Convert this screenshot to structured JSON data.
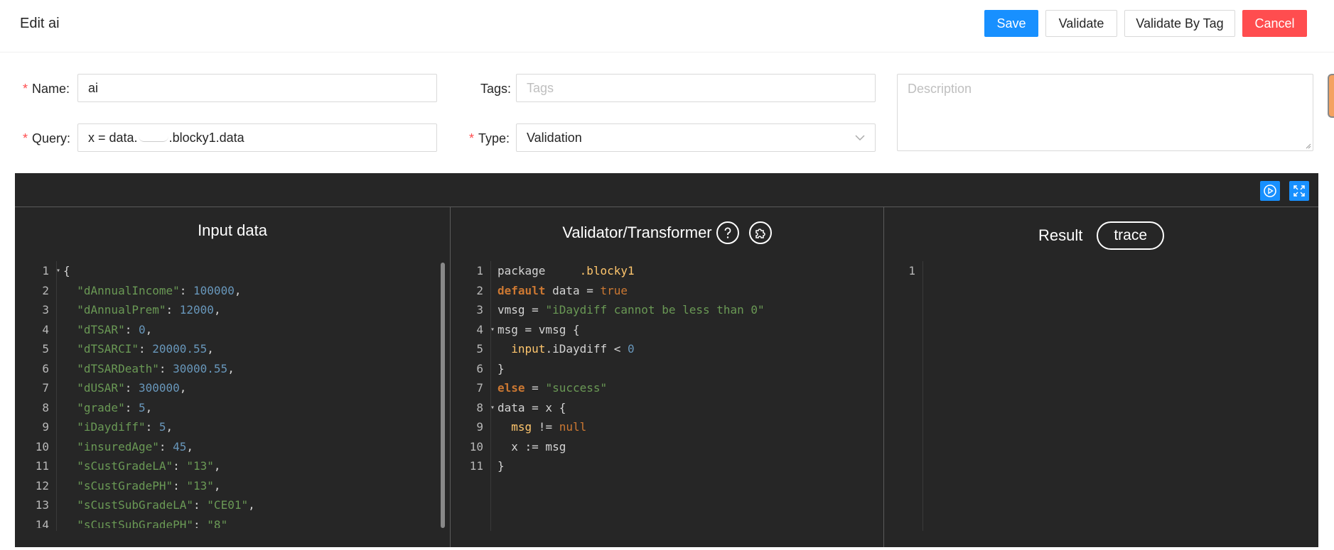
{
  "header": {
    "title": "Edit ai",
    "save": "Save",
    "validate": "Validate",
    "validate_by_tag": "Validate By Tag",
    "cancel": "Cancel"
  },
  "form": {
    "name_label": "Name:",
    "name_value": "ai",
    "tags_label": "Tags:",
    "tags_placeholder": "Tags",
    "description_placeholder": "Description",
    "query_label": "Query:",
    "query_value": "x = data.",
    "query_value_suffix": ".blocky1.data",
    "type_label": "Type:",
    "type_value": "Validation",
    "required_mark": "*"
  },
  "panels": {
    "input_title": "Input data",
    "validator_title": "Validator/Transformer",
    "result_title": "Result",
    "trace_label": "trace"
  },
  "input_code": [
    {
      "n": "1",
      "fold": true,
      "tokens": [
        [
          "p",
          "{"
        ]
      ]
    },
    {
      "n": "2",
      "tokens": [
        [
          "p",
          "  "
        ],
        [
          "s",
          "\"dAnnualIncome\""
        ],
        [
          "p",
          ": "
        ],
        [
          "n",
          "100000"
        ],
        [
          "p",
          ","
        ]
      ]
    },
    {
      "n": "3",
      "tokens": [
        [
          "p",
          "  "
        ],
        [
          "s",
          "\"dAnnualPrem\""
        ],
        [
          "p",
          ": "
        ],
        [
          "n",
          "12000"
        ],
        [
          "p",
          ","
        ]
      ]
    },
    {
      "n": "4",
      "tokens": [
        [
          "p",
          "  "
        ],
        [
          "s",
          "\"dTSAR\""
        ],
        [
          "p",
          ": "
        ],
        [
          "n",
          "0"
        ],
        [
          "p",
          ","
        ]
      ]
    },
    {
      "n": "5",
      "tokens": [
        [
          "p",
          "  "
        ],
        [
          "s",
          "\"dTSARCI\""
        ],
        [
          "p",
          ": "
        ],
        [
          "n",
          "20000.55"
        ],
        [
          "p",
          ","
        ]
      ]
    },
    {
      "n": "6",
      "tokens": [
        [
          "p",
          "  "
        ],
        [
          "s",
          "\"dTSARDeath\""
        ],
        [
          "p",
          ": "
        ],
        [
          "n",
          "30000.55"
        ],
        [
          "p",
          ","
        ]
      ]
    },
    {
      "n": "7",
      "tokens": [
        [
          "p",
          "  "
        ],
        [
          "s",
          "\"dUSAR\""
        ],
        [
          "p",
          ": "
        ],
        [
          "n",
          "300000"
        ],
        [
          "p",
          ","
        ]
      ]
    },
    {
      "n": "8",
      "tokens": [
        [
          "p",
          "  "
        ],
        [
          "s",
          "\"grade\""
        ],
        [
          "p",
          ": "
        ],
        [
          "n",
          "5"
        ],
        [
          "p",
          ","
        ]
      ]
    },
    {
      "n": "9",
      "tokens": [
        [
          "p",
          "  "
        ],
        [
          "s",
          "\"iDaydiff\""
        ],
        [
          "p",
          ": "
        ],
        [
          "n",
          "5"
        ],
        [
          "p",
          ","
        ]
      ]
    },
    {
      "n": "10",
      "tokens": [
        [
          "p",
          "  "
        ],
        [
          "s",
          "\"insuredAge\""
        ],
        [
          "p",
          ": "
        ],
        [
          "n",
          "45"
        ],
        [
          "p",
          ","
        ]
      ]
    },
    {
      "n": "11",
      "tokens": [
        [
          "p",
          "  "
        ],
        [
          "s",
          "\"sCustGradeLA\""
        ],
        [
          "p",
          ": "
        ],
        [
          "s",
          "\"13\""
        ],
        [
          "p",
          ","
        ]
      ]
    },
    {
      "n": "12",
      "tokens": [
        [
          "p",
          "  "
        ],
        [
          "s",
          "\"sCustGradePH\""
        ],
        [
          "p",
          ": "
        ],
        [
          "s",
          "\"13\""
        ],
        [
          "p",
          ","
        ]
      ]
    },
    {
      "n": "13",
      "tokens": [
        [
          "p",
          "  "
        ],
        [
          "s",
          "\"sCustSubGradeLA\""
        ],
        [
          "p",
          ": "
        ],
        [
          "s",
          "\"CE01\""
        ],
        [
          "p",
          ","
        ]
      ]
    },
    {
      "n": "14",
      "tokens": [
        [
          "p",
          "  "
        ],
        [
          "s",
          "\"sCustSubGradePH\""
        ],
        [
          "p",
          ": "
        ],
        [
          "s",
          "\"8\""
        ]
      ]
    }
  ],
  "validator_code": [
    {
      "n": "1",
      "tokens": [
        [
          "p",
          "package     "
        ],
        [
          "y",
          ".blocky1"
        ]
      ]
    },
    {
      "n": "2",
      "tokens": [
        [
          "k",
          "default"
        ],
        [
          "p",
          " data = "
        ],
        [
          "o",
          "true"
        ]
      ]
    },
    {
      "n": "3",
      "tokens": [
        [
          "p",
          "vmsg = "
        ],
        [
          "s",
          "\"iDaydiff cannot be less than 0\""
        ]
      ]
    },
    {
      "n": "4",
      "fold": true,
      "tokens": [
        [
          "p",
          "msg = vmsg {"
        ]
      ]
    },
    {
      "n": "5",
      "tokens": [
        [
          "p",
          "  "
        ],
        [
          "y",
          "input"
        ],
        [
          "p",
          ".iDaydiff < "
        ],
        [
          "n",
          "0"
        ]
      ]
    },
    {
      "n": "6",
      "tokens": [
        [
          "p",
          "}"
        ]
      ]
    },
    {
      "n": "7",
      "tokens": [
        [
          "k",
          "else"
        ],
        [
          "p",
          " = "
        ],
        [
          "s",
          "\"success\""
        ]
      ]
    },
    {
      "n": "8",
      "fold": true,
      "tokens": [
        [
          "p",
          "data = x {"
        ]
      ]
    },
    {
      "n": "9",
      "tokens": [
        [
          "p",
          "  "
        ],
        [
          "y",
          "msg"
        ],
        [
          "p",
          " != "
        ],
        [
          "o",
          "null"
        ]
      ]
    },
    {
      "n": "10",
      "tokens": [
        [
          "p",
          "  x := msg"
        ]
      ]
    },
    {
      "n": "11",
      "tokens": [
        [
          "p",
          "}"
        ]
      ]
    }
  ],
  "result_code": [
    {
      "n": "1",
      "tokens": []
    }
  ],
  "icons": {
    "help": "question-circle-icon",
    "plugin": "puzzle-icon",
    "run": "play-circle-icon",
    "fullscreen": "fullscreen-icon",
    "dropdown": "chevron-down-icon"
  },
  "colors": {
    "primary": "#1890ff",
    "danger": "#ff4d4f",
    "editor_bg": "#262626"
  }
}
